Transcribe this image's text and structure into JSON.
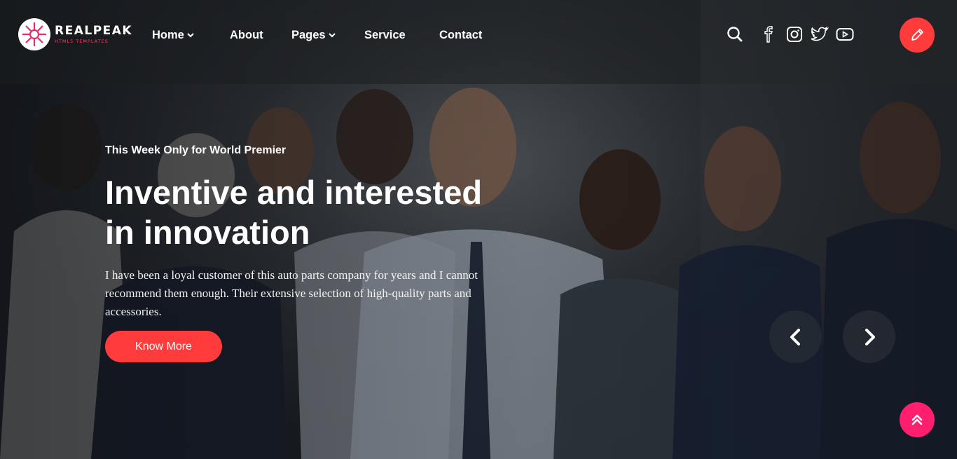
{
  "brand": {
    "name": "REALPEAK",
    "tagline": "HTML5 TEMPLATES",
    "accent": "#ff3b3b",
    "to_top_color": "#ff1f6e"
  },
  "nav": {
    "items": [
      {
        "label": "Home",
        "has_dropdown": true
      },
      {
        "label": "About",
        "has_dropdown": false
      },
      {
        "label": "Pages",
        "has_dropdown": true
      },
      {
        "label": "Service",
        "has_dropdown": false
      },
      {
        "label": "Contact",
        "has_dropdown": false
      }
    ]
  },
  "header_icons": [
    "search-icon",
    "facebook-icon",
    "instagram-icon",
    "twitter-icon",
    "youtube-icon",
    "pencil-icon"
  ],
  "hero": {
    "kicker": "This Week Only for World Premier",
    "headline_line1": "Inventive and interested",
    "headline_line2": "in innovation",
    "description": "I have been a loyal customer of this auto parts company for years and I cannot recommend them enough. Their extensive selection of high-quality parts and accessories.",
    "cta_label": "Know More"
  },
  "slider": {
    "prev_icon": "chevron-left-icon",
    "next_icon": "chevron-right-icon"
  },
  "scroll_top_icon": "double-chevron-up-icon"
}
